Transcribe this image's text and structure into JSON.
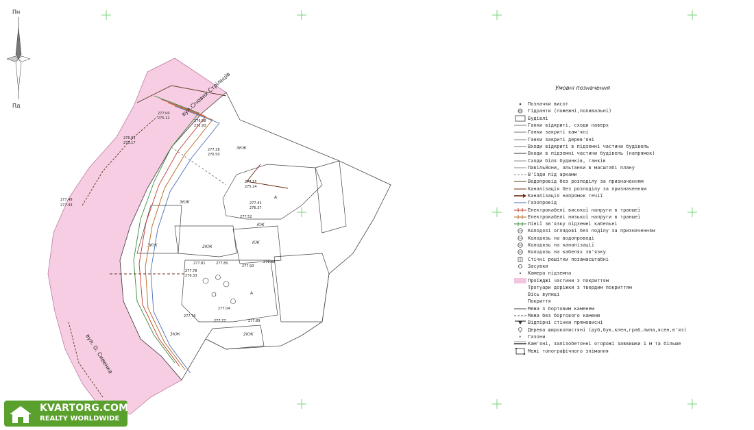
{
  "compass": {
    "north": "Пн",
    "south": "Пд"
  },
  "streets": {
    "top": "вул.Січових Стрільців",
    "bottom": "вул. О. Сивенка"
  },
  "zones": {
    "ag_label": "A",
    "zhk_label": "3КЖ",
    "kzh_label": "КЖ",
    "zhk2_label": "2КЖ"
  },
  "elevations": [
    "277.00",
    "275.12",
    "276.98",
    "275.93",
    "276.91",
    "275.17",
    "277.28",
    "276.50",
    "277.15",
    "275.24",
    "277.42",
    "276.37",
    "277.52",
    "277.48",
    "277.43",
    "277.81",
    "277.80",
    "277.93",
    "278.08",
    "277.78",
    "276.33",
    "277.76",
    "277.04",
    "277.77",
    "277.89"
  ],
  "legend": {
    "title": "Умовні позначення",
    "items": [
      {
        "sym": "dot",
        "color": "#333333",
        "text": "Позначки висот"
      },
      {
        "sym": "hydrant",
        "color": "#333333",
        "text": "Гідранти (пожежні,поливальні)"
      },
      {
        "sym": "box",
        "color": "#333333",
        "text": "Будівлі"
      },
      {
        "sym": "line",
        "color": "#777777",
        "text": "Ганки відкриті, сходи наверх"
      },
      {
        "sym": "line",
        "color": "#777777",
        "text": "Ганки закриті кам'яні"
      },
      {
        "sym": "line",
        "color": "#777777",
        "text": "Ганки закриті дерев'яні"
      },
      {
        "sym": "line",
        "color": "#777777",
        "text": "Входи відкриті в підземні частини будівель"
      },
      {
        "sym": "line",
        "color": "#333333",
        "text": "Входи в підземні частини будівель (напрямок)"
      },
      {
        "sym": "line",
        "color": "#888888",
        "text": "Сходи біля будинків, ганків"
      },
      {
        "sym": "line",
        "color": "#888888",
        "text": "Павільйони, альтанки в масштабі плану"
      },
      {
        "sym": "dash",
        "color": "#888888",
        "text": "В'їзди під арками"
      },
      {
        "sym": "line",
        "color": "#5a3a1a",
        "text": "Водопровід без розподілу за призначенням"
      },
      {
        "sym": "line",
        "color": "#6b2a10",
        "text": "Каналізація без розподілу за призначенням"
      },
      {
        "sym": "arrow",
        "color": "#6b2a10",
        "text": "Каналізація напрямок течії"
      },
      {
        "sym": "line",
        "color": "#4a6fb5",
        "text": "Газопровід"
      },
      {
        "sym": "cross",
        "color": "#c0392b",
        "text": "Електрокабелі високої напруги в траншеї"
      },
      {
        "sym": "cross",
        "color": "#b5651d",
        "text": "Електрокабелі низької напруги в траншеї"
      },
      {
        "sym": "cross",
        "color": "#3a8a3a",
        "text": "Лінії зв'язку підземні кабельні"
      },
      {
        "sym": "circle",
        "color": "#333333",
        "text": "Колодязі оглядові без поділу за призначенням"
      },
      {
        "sym": "circle",
        "color": "#333333",
        "text": "Колодязь на водопроводі"
      },
      {
        "sym": "circle",
        "color": "#333333",
        "text": "Колодязь на каналізації"
      },
      {
        "sym": "circle",
        "color": "#333333",
        "text": "Колодязь на кабелях зв'язку"
      },
      {
        "sym": "grid",
        "color": "#333333",
        "text": "Стічні решітки позамасштабні"
      },
      {
        "sym": "ring",
        "color": "#333333",
        "text": "Засувки"
      },
      {
        "sym": "dotsm",
        "color": "#333333",
        "text": "Камера підземна"
      },
      {
        "sym": "pink",
        "color": "#f3c6e0",
        "text": "Проїжджі частини з покриттям"
      },
      {
        "sym": "none",
        "color": "#333333",
        "text": "Тротуари доріжки з твердим покриттям"
      },
      {
        "sym": "none",
        "color": "#333333",
        "text": "Вісь вулиці"
      },
      {
        "sym": "none",
        "color": "#333333",
        "text": "Покриття"
      },
      {
        "sym": "line",
        "color": "#444444",
        "text": "Межа з бортовим каменем"
      },
      {
        "sym": "dash",
        "color": "#444444",
        "text": "Межа без бортового каменю"
      },
      {
        "sym": "wall",
        "color": "#333333",
        "text": "Відпірні стінки прямовисні"
      },
      {
        "sym": "tree",
        "color": "#333333",
        "text": "Дерева широколистяні (дуб,бук,клен,граб,липа,ясен,в'яз)"
      },
      {
        "sym": "star",
        "color": "#333333",
        "text": "Газони"
      },
      {
        "sym": "fence",
        "color": "#333333",
        "text": "Кам'яні, залізобетонні огорожі заввишки 1 м та більше"
      },
      {
        "sym": "bounds",
        "color": "#333333",
        "text": "Межі топографічного знімання"
      }
    ]
  },
  "watermark": {
    "line1": "KVARTORG.COM",
    "line2": "REALTY WORLDWIDE"
  }
}
